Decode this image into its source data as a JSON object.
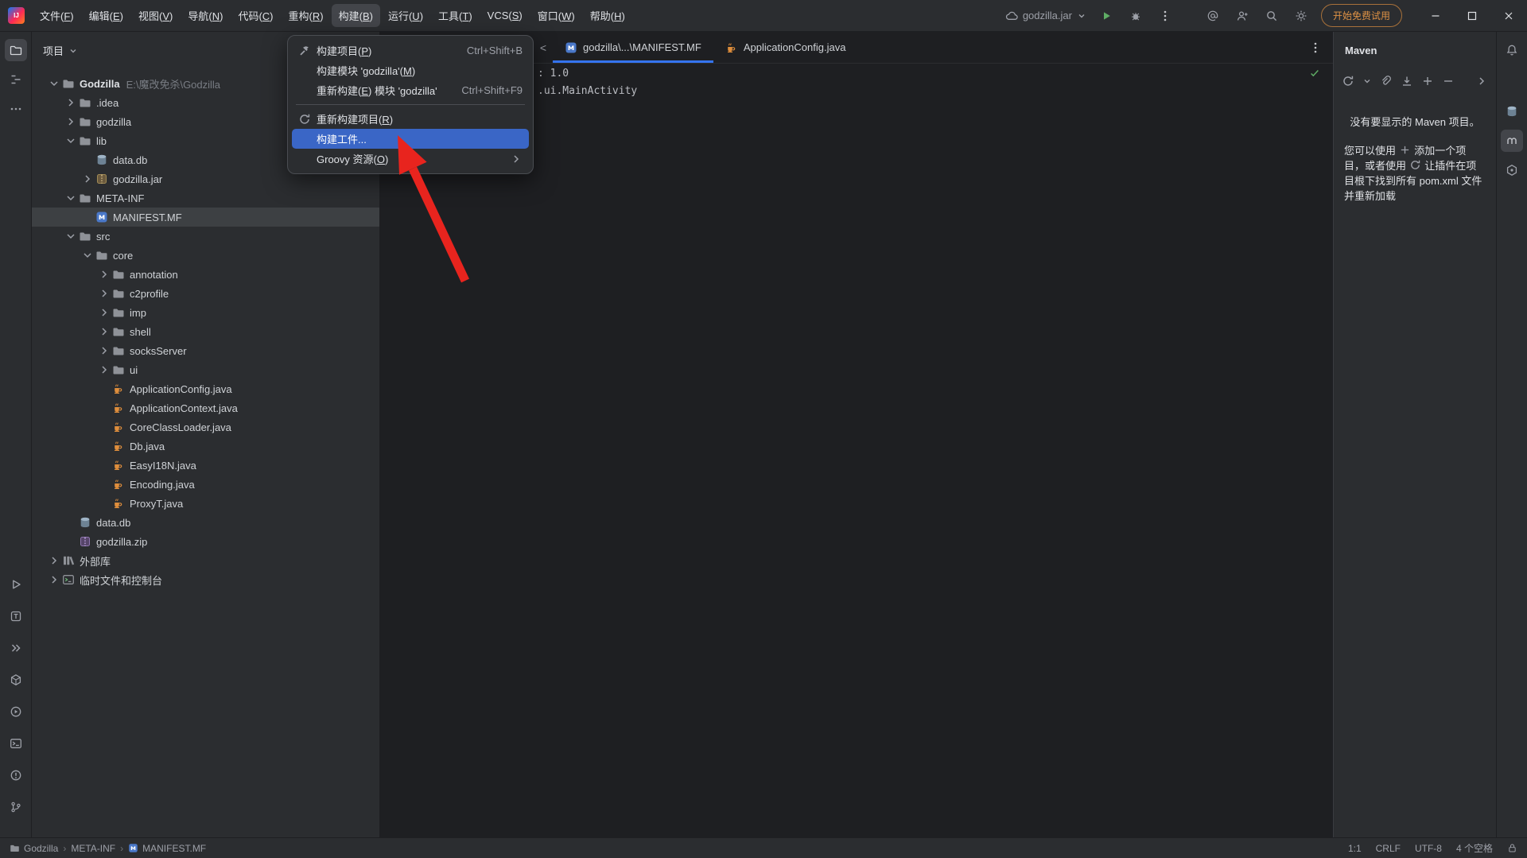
{
  "colors": {
    "accent": "#3574f0",
    "menu_selection": "#3a66c6",
    "trial_orange": "#dd9145",
    "arrow_red": "#e8241e",
    "run_green": "#5fad65",
    "check_green": "#5fad65"
  },
  "titlebar": {
    "menus": [
      {
        "name": "file",
        "label": "文件(F)"
      },
      {
        "name": "edit",
        "label": "编辑(E)"
      },
      {
        "name": "view",
        "label": "视图(V)"
      },
      {
        "name": "navigate",
        "label": "导航(N)"
      },
      {
        "name": "code",
        "label": "代码(C)"
      },
      {
        "name": "refactor",
        "label": "重构(R)"
      },
      {
        "name": "build",
        "label": "构建(B)",
        "open": true
      },
      {
        "name": "run",
        "label": "运行(U)"
      },
      {
        "name": "tools",
        "label": "工具(T)"
      },
      {
        "name": "vcs",
        "label": "VCS(S)"
      },
      {
        "name": "window",
        "label": "窗口(W)"
      },
      {
        "name": "help",
        "label": "帮助(H)"
      }
    ],
    "run_config_label": "godzilla.jar",
    "trial_button_label": "开始免费试用"
  },
  "left_stripe": {
    "top": [
      {
        "icon": "project-folder",
        "name": "project-tool-icon",
        "active": true
      },
      {
        "icon": "structure",
        "name": "structure-tool-icon"
      },
      {
        "icon": "more",
        "name": "more-tools-icon"
      }
    ],
    "bottom": [
      {
        "icon": "run",
        "name": "run-tool-icon"
      },
      {
        "icon": "todo",
        "name": "todo-tool-icon"
      },
      {
        "icon": "double-chevron",
        "name": "more-tool-windows-icon"
      },
      {
        "icon": "build-box",
        "name": "build-tool-icon"
      },
      {
        "icon": "services",
        "name": "services-tool-icon"
      },
      {
        "icon": "terminal",
        "name": "terminal-tool-icon"
      },
      {
        "icon": "problems",
        "name": "problems-tool-icon"
      },
      {
        "icon": "git-branch",
        "name": "version-control-tool-icon"
      }
    ]
  },
  "right_stripe": {
    "top": [
      {
        "icon": "bell",
        "name": "notifications-icon"
      }
    ],
    "mid": [
      {
        "icon": "database",
        "name": "database-tool-icon"
      },
      {
        "icon": "maven-m",
        "name": "maven-tool-icon",
        "active": true
      },
      {
        "icon": "dependencies-hex",
        "name": "dependencies-tool-icon"
      }
    ]
  },
  "project_panel": {
    "title": "项目",
    "tree": [
      {
        "level": 0,
        "chevron": "down",
        "icon": "folder",
        "label": "Godzilla",
        "hint": "E:\\魔改免杀\\Godzilla",
        "bold": true
      },
      {
        "level": 1,
        "chevron": "right",
        "icon": "folder",
        "label": ".idea"
      },
      {
        "level": 1,
        "chevron": "right",
        "icon": "folder",
        "label": "godzilla"
      },
      {
        "level": 1,
        "chevron": "down",
        "icon": "folder",
        "label": "lib"
      },
      {
        "level": 2,
        "chevron": null,
        "icon": "database",
        "label": "data.db"
      },
      {
        "level": 2,
        "chevron": "right",
        "icon": "jar",
        "label": "godzilla.jar"
      },
      {
        "level": 1,
        "chevron": "down",
        "icon": "folder",
        "label": "META-INF"
      },
      {
        "level": 2,
        "chevron": null,
        "icon": "manifest",
        "label": "MANIFEST.MF",
        "selected": true
      },
      {
        "level": 1,
        "chevron": "down",
        "icon": "folder",
        "label": "src"
      },
      {
        "level": 2,
        "chevron": "down",
        "icon": "folder",
        "label": "core"
      },
      {
        "level": 3,
        "chevron": "right",
        "icon": "folder",
        "label": "annotation"
      },
      {
        "level": 3,
        "chevron": "right",
        "icon": "folder",
        "label": "c2profile"
      },
      {
        "level": 3,
        "chevron": "right",
        "icon": "folder",
        "label": "imp"
      },
      {
        "level": 3,
        "chevron": "right",
        "icon": "folder",
        "label": "shell"
      },
      {
        "level": 3,
        "chevron": "right",
        "icon": "folder",
        "label": "socksServer"
      },
      {
        "level": 3,
        "chevron": "right",
        "icon": "folder",
        "label": "ui"
      },
      {
        "level": 3,
        "chevron": null,
        "icon": "java-file",
        "label": "ApplicationConfig.java"
      },
      {
        "level": 3,
        "chevron": null,
        "icon": "java-file",
        "label": "ApplicationContext.java"
      },
      {
        "level": 3,
        "chevron": null,
        "icon": "java-file",
        "label": "CoreClassLoader.java"
      },
      {
        "level": 3,
        "chevron": null,
        "icon": "java-file",
        "label": "Db.java"
      },
      {
        "level": 3,
        "chevron": null,
        "icon": "java-file",
        "label": "EasyI18N.java"
      },
      {
        "level": 3,
        "chevron": null,
        "icon": "java-file",
        "label": "Encoding.java"
      },
      {
        "level": 3,
        "chevron": null,
        "icon": "java-file",
        "label": "ProxyT.java"
      },
      {
        "level": 1,
        "chevron": null,
        "icon": "database",
        "label": "data.db"
      },
      {
        "level": 1,
        "chevron": null,
        "icon": "zip",
        "label": "godzilla.zip"
      },
      {
        "level": 0,
        "chevron": "right",
        "icon": "libraries",
        "label": "外部库"
      },
      {
        "level": 0,
        "chevron": "right",
        "icon": "console",
        "label": "临时文件和控制台"
      }
    ]
  },
  "build_menu": {
    "items": [
      {
        "name": "build-project",
        "icon": "hammer",
        "label": "构建项目(P)",
        "shortcut": "Ctrl+Shift+B"
      },
      {
        "name": "build-module",
        "label": "构建模块 'godzilla'(M)"
      },
      {
        "name": "rebuild-module",
        "label": "重新构建(E) 模块 'godzilla'",
        "shortcut": "Ctrl+Shift+F9"
      },
      {
        "separator": true
      },
      {
        "name": "rebuild-project",
        "icon": "rebuild",
        "label": "重新构建项目(R)"
      },
      {
        "name": "build-artifacts",
        "label": "构建工件...",
        "selected": true
      },
      {
        "name": "groovy-resources",
        "label": "Groovy 资源(O)",
        "submenu": true
      }
    ]
  },
  "editor": {
    "tab_overflow": "<",
    "tabs": [
      {
        "name": "tab-manifest",
        "icon": "manifest",
        "label": "godzilla\\...\\MANIFEST.MF",
        "selected": true
      },
      {
        "name": "tab-applicationconfig",
        "icon": "java-file",
        "label": "ApplicationConfig.java",
        "selected": false
      }
    ],
    "fragments": [
      {
        "text": ": 1.0"
      },
      {
        "text": ".ui.MainActivity"
      }
    ]
  },
  "maven_panel": {
    "title": "Maven",
    "toolbar_icons": [
      "sync",
      "chevron-down-sm",
      "attach",
      "download",
      "add",
      "remove"
    ],
    "collapse_icon": "chevron-right",
    "empty_title": "没有要显示的 Maven 项目。",
    "empty_hint_parts": [
      {
        "text": "您可以使用 "
      },
      {
        "icon": "add"
      },
      {
        "text": " 添加一个项目，或者使用 "
      },
      {
        "icon": "sync"
      },
      {
        "text": " 让插件在项目根下找到所有 pom.xml 文件并重新加载"
      }
    ]
  },
  "status_bar": {
    "breadcrumbs": [
      {
        "icon": "folder",
        "label": "Godzilla"
      },
      {
        "label": "META-INF"
      },
      {
        "icon": "manifest",
        "label": "MANIFEST.MF"
      }
    ],
    "caret": "1:1",
    "line_separator": "CRLF",
    "encoding": "UTF-8",
    "indent": "4 个空格"
  }
}
